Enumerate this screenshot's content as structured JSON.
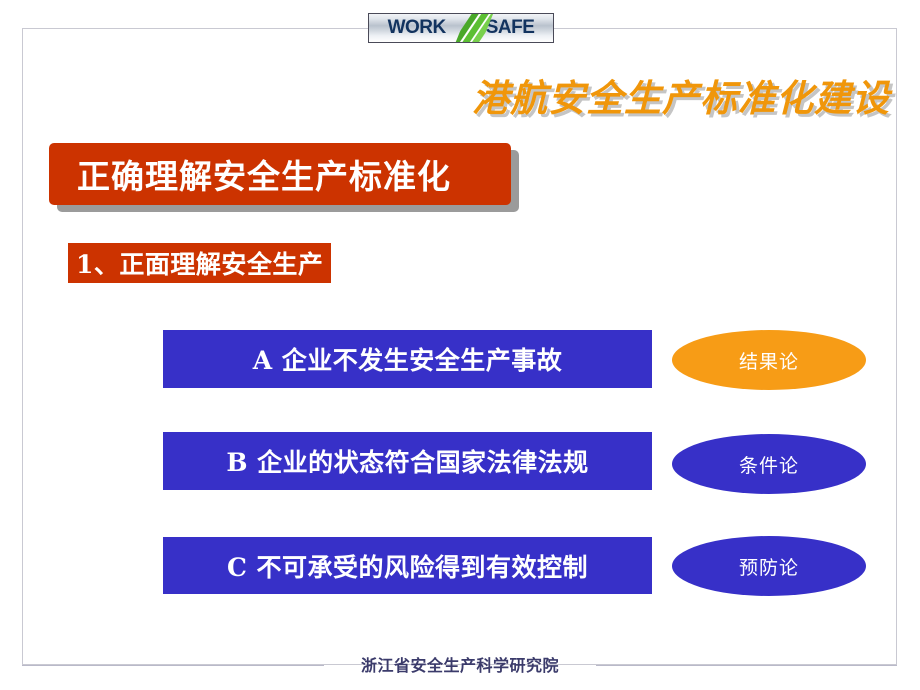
{
  "slide": {
    "logo": {
      "word_left": "WORK",
      "word_right": "SAFE",
      "slash_icon": "green-slash-icon"
    },
    "header_title": "港航安全生产标准化建设",
    "banner_title": "正确理解安全生产标准化",
    "subheading": "1、正面理解安全生产",
    "rows": [
      {
        "id": "a",
        "text": "A 企业不发生安全生产事故",
        "tag": "结果论",
        "tag_color": "#F79C16",
        "box_color": "#3730C8"
      },
      {
        "id": "b",
        "text": "B 企业的状态符合国家法律法规",
        "tag": "条件论",
        "tag_color": "#3730C8",
        "box_color": "#3730C8"
      },
      {
        "id": "c",
        "text": "C 不可承受的风险得到有效控制",
        "tag": "预防论",
        "tag_color": "#3730C8",
        "box_color": "#3730C8"
      }
    ],
    "footer": "浙江省安全生产科学研究院",
    "colors": {
      "banner_red": "#CC3300",
      "header_orange": "#F0960A",
      "box_blue": "#3730C8",
      "tag_orange": "#F79C16",
      "footer_navy": "#3B3B6B",
      "frame_border": "#C9C9D2"
    }
  }
}
